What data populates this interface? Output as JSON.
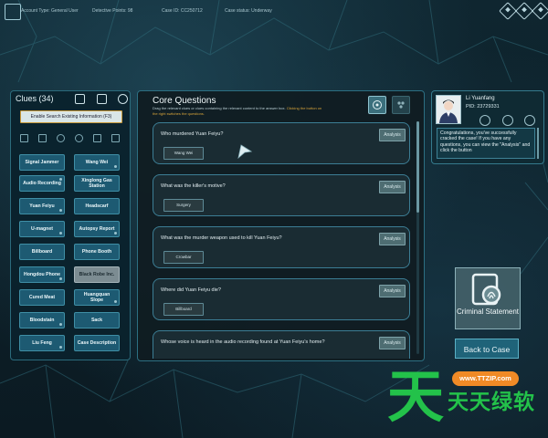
{
  "topbar": {
    "account_type": "Account Type: General User",
    "detective_points": "Detective Points: 98",
    "case_id": "Case ID: CC250712",
    "case_status": "Case status: Underway"
  },
  "clues": {
    "title": "Clues",
    "count": "(34)",
    "search_placeholder": "Enable Search Existing Information (F3)",
    "items": [
      "Signal Jammer",
      "Wang Wei",
      "Audio Recording",
      "Xinglong Gas Station",
      "Yuan Feiyu",
      "Headscarf",
      "U-magnet",
      "Autopsy Report",
      "Billboard",
      "Phone Booth",
      "Hongdou Phone",
      "Black Robe Inc.",
      "Cured Meat",
      "Huangquan Slope",
      "Bloodstain",
      "Sack",
      "Liu Feng",
      "Case Description"
    ]
  },
  "core": {
    "title": "Core Questions",
    "instruction": "Drag the relevant clues or clues containing the relevant content to the answer box.",
    "instruction_hint": "Clicking the button on the right switches the questions.",
    "analysis_label": "Analysis",
    "questions": [
      {
        "text": "Who murdered Yuan Feiyu?",
        "answer": "Wang Wei"
      },
      {
        "text": "What was the killer's motive?",
        "answer": "Surgery"
      },
      {
        "text": "What was the murder weapon used to kill Yuan Feiyu?",
        "answer": "Crowbar"
      },
      {
        "text": "Where did Yuan Feiyu die?",
        "answer": "Billboard"
      },
      {
        "text": "Whose voice is heard in the audio recording found at Yuan Feiyu's home?",
        "answer": ""
      }
    ]
  },
  "chat": {
    "name": "Li Yuanfang",
    "pid": "PID: 23729331",
    "message": "Congratulations, you've successfully cracked the case! If you have any questions, you can view the \"Analysis\" and click the button"
  },
  "side": {
    "statement_label": "Criminal Statement",
    "back_label": "Back to Case"
  },
  "watermark": {
    "url": "www.TTZIP.com",
    "big": "天",
    "small": "天天绿软"
  },
  "colors": {
    "accent": "#3c7e95",
    "button": "#1d5a72",
    "highlight": "#d7a43a",
    "watermark_green": "#23c24a",
    "watermark_orange": "#f08a26"
  }
}
